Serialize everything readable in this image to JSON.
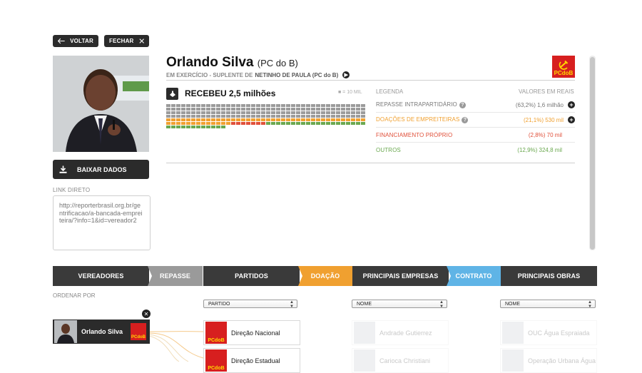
{
  "toolbar": {
    "back_label": "VOLTAR",
    "close_label": "FECHAR"
  },
  "profile": {
    "name": "Orlando Silva",
    "party": "(PC do B)",
    "status_prefix": "EM EXERCÍCIO - SUPLENTE DE",
    "status_name": "NETINHO DE PAULA (PC do B)",
    "logo_text": "PCdoB"
  },
  "download_label": "BAIXAR DADOS",
  "link": {
    "label": "LINK DIRETO",
    "value": "http://reporterbrasil.org.br/gentrificacao/a-bancada-empreiteira/?info=1&id=vereador2"
  },
  "received": {
    "title": "RECEBEU 2,5 milhões",
    "scale": "■ = 10 MIL"
  },
  "legend": {
    "header_left": "LEGENDA",
    "header_right": "VALORES EM REAIS",
    "rows": [
      {
        "label": "REPASSE INTRAPARTIDÁRIO",
        "value": "(63,2%) 1,6 milhão",
        "color": "#777777",
        "help": "?",
        "expand": "+"
      },
      {
        "label": "DOAÇÕES DE EMPREITEIRAS",
        "value": "(21,1%) 530 mil",
        "color": "#f0a030",
        "help": "?",
        "expand": "+"
      },
      {
        "label": "FINANCIAMENTO PRÓPRIO",
        "value": "(2,8%) 70 mil",
        "color": "#e0503a"
      },
      {
        "label": "OUTROS",
        "value": "(12,9%) 324,8 mil",
        "color": "#6aa84f"
      }
    ]
  },
  "waffle": {
    "gray": 160,
    "orange": 53,
    "red": 7,
    "green": 32,
    "colors": {
      "gray": "#9b9b9b",
      "orange": "#f0a030",
      "red": "#e0503a",
      "green": "#6aa84f"
    }
  },
  "tabs": [
    {
      "label": "VEREADORES",
      "bg": "#3a3a3a"
    },
    {
      "label": "REPASSE",
      "bg": "#9a9a9a"
    },
    {
      "label": "PARTIDOS",
      "bg": "#3a3a3a"
    },
    {
      "label": "DOAÇÃO",
      "bg": "#f0a030"
    },
    {
      "label": "PRINCIPAIS EMPRESAS",
      "bg": "#3a3a3a"
    },
    {
      "label": "CONTRATO",
      "bg": "#5fb4e6"
    },
    {
      "label": "PRINCIPAIS OBRAS",
      "bg": "#3a3a3a"
    }
  ],
  "order_label": "ORDENAR POR",
  "selects": {
    "partido": "PARTIDO",
    "empresas": "NOME",
    "obras": "NOME"
  },
  "person_card": {
    "name": "Orlando Silva",
    "logo": "PCdoB"
  },
  "parties": [
    {
      "label": "Direção Nacional",
      "logo": "PCdoB"
    },
    {
      "label": "Direção Estadual",
      "logo": "PCdoB"
    }
  ],
  "companies": [
    "Andrade Gutierrez",
    "Carioca Christiani"
  ],
  "works": [
    "OUC Água Espraiada",
    "Operação Urbana Água"
  ]
}
